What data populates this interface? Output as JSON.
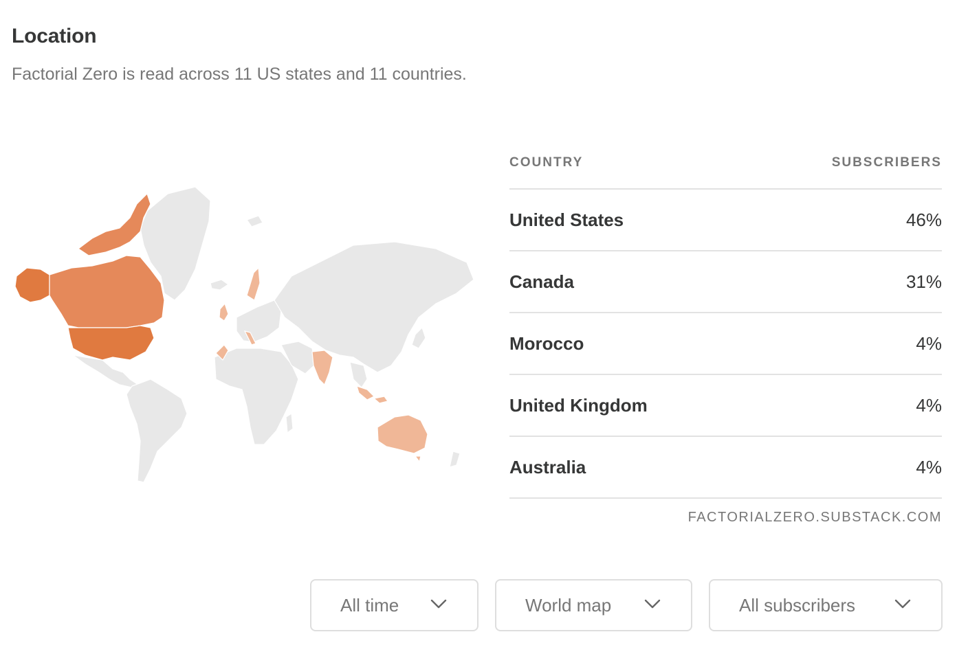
{
  "header": {
    "title": "Location",
    "subtitle": "Factorial Zero is read across 11 US states and 11 countries."
  },
  "map": {
    "land_color": "#e8e8e8",
    "highlight_colors": {
      "United States": "#e07a40",
      "Canada": "#e5895a",
      "Alaska": "#e07a40",
      "Greenland-north": "#e5895a",
      "low": "#f0b797"
    }
  },
  "table": {
    "col_country": "COUNTRY",
    "col_subscribers": "SUBSCRIBERS",
    "rows": [
      {
        "country": "United States",
        "value": "46%"
      },
      {
        "country": "Canada",
        "value": "31%"
      },
      {
        "country": "Morocco",
        "value": "4%"
      },
      {
        "country": "United Kingdom",
        "value": "4%"
      },
      {
        "country": "Australia",
        "value": "4%"
      }
    ],
    "footer": "FACTORIALZERO.SUBSTACK.COM"
  },
  "filters": {
    "time": "All time",
    "view": "World map",
    "audience": "All subscribers"
  }
}
